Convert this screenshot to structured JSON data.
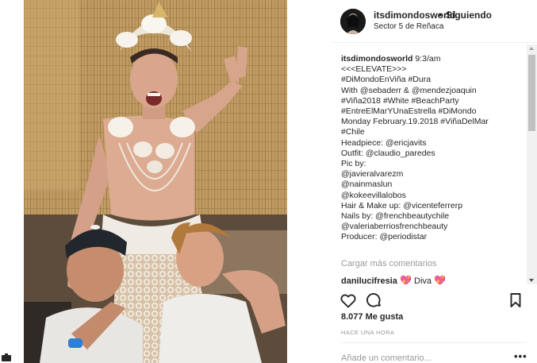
{
  "header": {
    "username": "itsdimondosworld",
    "bullet": "•",
    "follow_label": "Siguiendo",
    "location": "Sector 5 de Reñaca"
  },
  "caption": {
    "username": "itsdimondosworld",
    "time": "9:3/am",
    "lines": [
      "<<<ELEVATE>>>",
      "#DiMondoEnViña #Dura",
      "With @sebaderr & @mendezjoaquin",
      "#Viña2018 #White #BeachParty",
      "#EntreElMarYUnaEstrella #DiMondo",
      "Monday February.19.2018 #ViñaDelMar",
      "#Chile",
      "Headpiece: @ericjavits",
      "Outfit: @claudio_paredes",
      "Pic by:",
      "@javieralvarezm",
      "@nainmaslun",
      "@kokeevillalobos",
      "Hair & Make up: @vicenteferrerp",
      "Nails by: @frenchbeautychile",
      "@valeriaberriosfrenchbeauty",
      "Producer: @periodistar"
    ]
  },
  "load_more": "Cargar más comentarios",
  "comment": {
    "username": "danilucifresia",
    "text": "Diva"
  },
  "likes": "8.077 Me gusta",
  "time_ago": "HACE UNA HORA",
  "add_comment_placeholder": "Añade un comentario...",
  "more_label": "•••",
  "icons": {
    "like": "heart-icon",
    "comment": "comment-icon",
    "save": "bookmark-icon",
    "heart_emoji": "heart-emoji-icon"
  },
  "colors": {
    "text": "#262626",
    "muted": "#999999",
    "divider": "#efefef",
    "heart_emoji": "#e0417a"
  }
}
